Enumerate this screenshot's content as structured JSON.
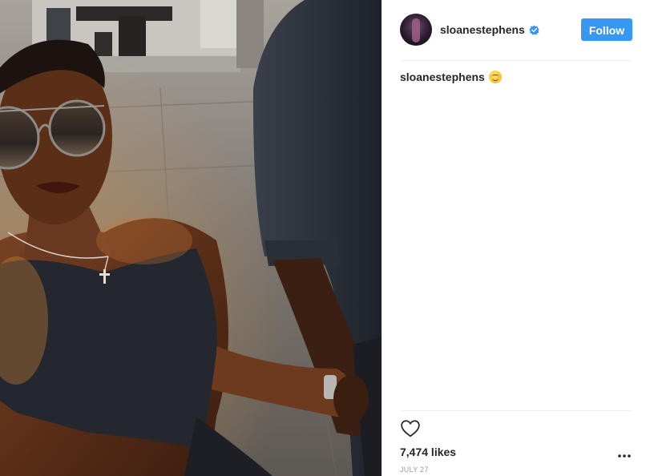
{
  "post": {
    "username": "sloanestephens",
    "follow_label": "Follow",
    "caption_text": "sloanestephens",
    "caption_emoji": "smiling-face-emoji",
    "likes": "7,474 likes",
    "date": "JULY 27"
  },
  "icons": {
    "verified": "verified-badge-icon",
    "like": "heart-icon",
    "more": "more-options-icon"
  },
  "colors": {
    "follow_button": "#3897f0",
    "verified_badge": "#3897f0",
    "text_primary": "#262626",
    "text_secondary": "#999999",
    "divider": "#efefef"
  }
}
